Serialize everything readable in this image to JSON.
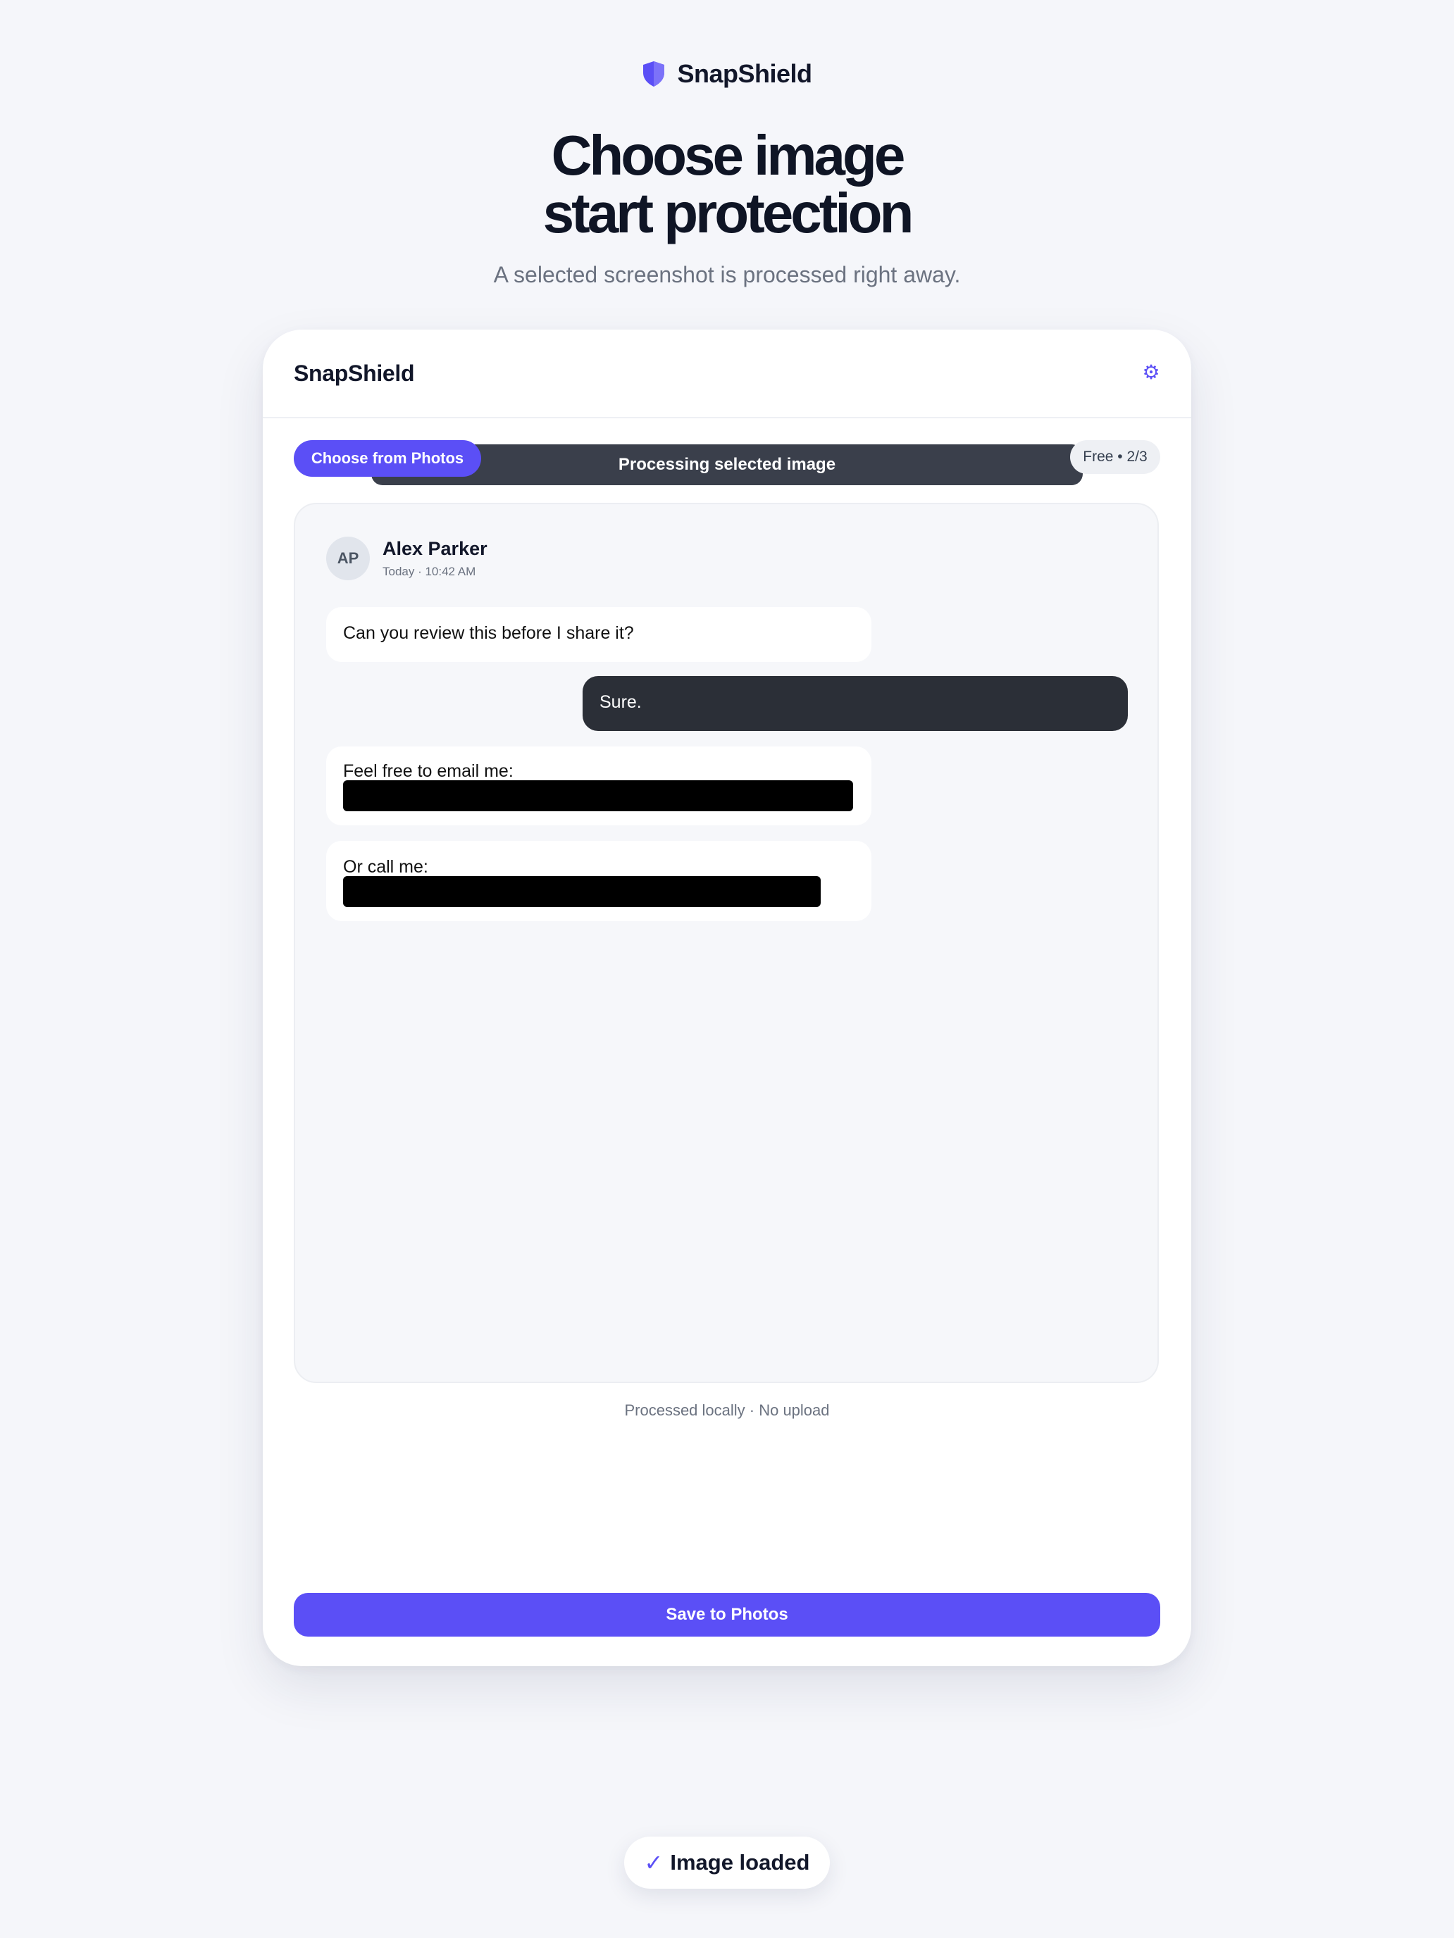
{
  "brand": {
    "name": "SnapShield",
    "icon": "shield-icon",
    "accent": "#5b4ff6"
  },
  "hero": {
    "title_line1": "Choose image",
    "title_line2": "start protection",
    "subtitle": "A selected screenshot is processed right away."
  },
  "card": {
    "title": "SnapShield",
    "settings_icon": "gear-icon",
    "toolbar": {
      "choose_label": "Choose from Photos",
      "processing_label": "Processing selected image",
      "quota_label": "Free • 2/3"
    },
    "preview": {
      "avatar_initials": "AP",
      "sender": "Alex Parker",
      "timestamp": "Today · 10:42 AM",
      "messages": [
        {
          "direction": "incoming",
          "text": "Can you review this before I share it?"
        },
        {
          "direction": "outgoing",
          "text": "Sure."
        },
        {
          "direction": "incoming",
          "text": "Feel free to email me:",
          "redacted": true
        },
        {
          "direction": "incoming",
          "text": "Or call me:",
          "redacted": true
        }
      ]
    },
    "note": "Processed locally · No upload",
    "save_label": "Save to Photos"
  },
  "toast": {
    "icon": "check-icon",
    "text": "Image loaded"
  }
}
